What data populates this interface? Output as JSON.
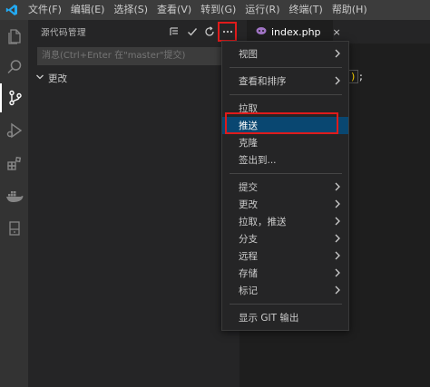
{
  "menubar": {
    "items": [
      "文件(F)",
      "编辑(E)",
      "选择(S)",
      "查看(V)",
      "转到(G)",
      "运行(R)",
      "终端(T)",
      "帮助(H)"
    ]
  },
  "activitybar": {
    "icons": [
      "files-icon",
      "search-icon",
      "source-control-icon",
      "run-debug-icon",
      "extensions-icon",
      "docker-icon",
      "remote-explorer-icon"
    ]
  },
  "sidebar": {
    "title": "源代码管理",
    "message_placeholder": "消息(Ctrl+Enter 在\"master\"提交)",
    "changes_label": "更改"
  },
  "tab": {
    "label": "index.php",
    "close_glyph": "×"
  },
  "editor": {
    "code_fragment": ");",
    "paren": ")"
  },
  "context_menu": {
    "items": [
      {
        "label": "视图",
        "submenu": true
      },
      {
        "label": "查看和排序",
        "submenu": true
      },
      {
        "label": "拉取",
        "submenu": false
      },
      {
        "label": "推送",
        "submenu": false,
        "selected": true
      },
      {
        "label": "克隆",
        "submenu": false
      },
      {
        "label": "签出到...",
        "submenu": false
      },
      {
        "label": "提交",
        "submenu": true
      },
      {
        "label": "更改",
        "submenu": true
      },
      {
        "label": "拉取，推送",
        "submenu": true
      },
      {
        "label": "分支",
        "submenu": true
      },
      {
        "label": "远程",
        "submenu": true
      },
      {
        "label": "存储",
        "submenu": true
      },
      {
        "label": "标记",
        "submenu": true
      },
      {
        "label": "显示 GIT 输出",
        "submenu": false
      }
    ]
  },
  "colors": {
    "accent_selected": "#094771",
    "highlight_box": "#e01b1b",
    "php_icon": "#a074c4",
    "vscode_blue": "#23a9f2"
  }
}
